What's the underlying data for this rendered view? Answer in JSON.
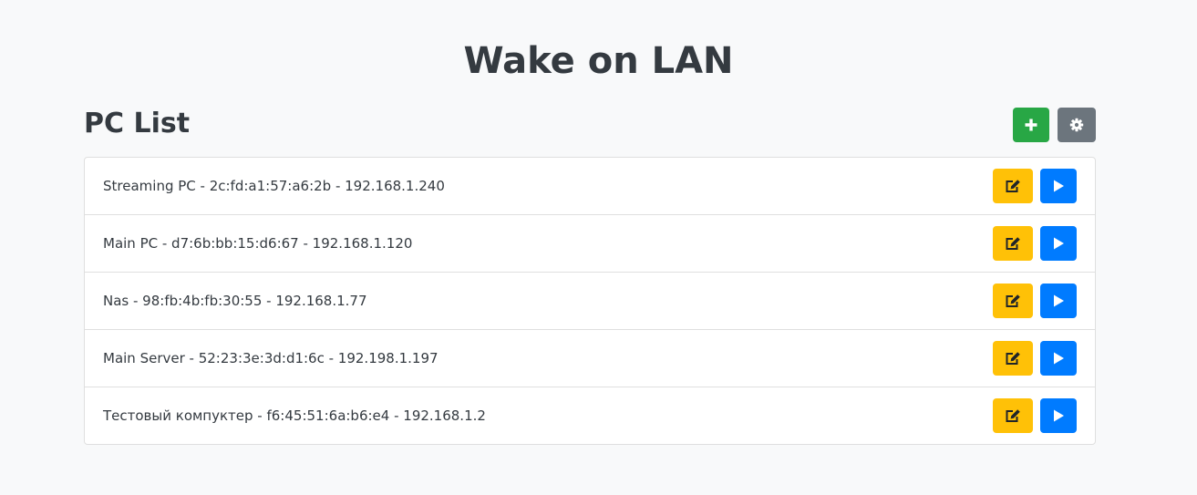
{
  "header": {
    "title": "Wake on LAN"
  },
  "list": {
    "heading": "PC List",
    "add_icon": "plus-icon",
    "settings_icon": "gear-icon",
    "row_edit_icon": "edit-icon",
    "row_wake_icon": "play-icon",
    "items": [
      {
        "label": "Streaming PC - 2c:fd:a1:57:a6:2b - 192.168.1.240"
      },
      {
        "label": "Main PC - d7:6b:bb:15:d6:67 - 192.168.1.120"
      },
      {
        "label": "Nas - 98:fb:4b:fb:30:55 - 192.168.1.77"
      },
      {
        "label": "Main Server - 52:23:3e:3d:d1:6c - 192.198.1.197"
      },
      {
        "label": "Тестовый компуктер - f6:45:51:6a:b6:e4 - 192.168.1.2"
      }
    ]
  },
  "colors": {
    "background": "#f8f9fa",
    "add_button": "#28a745",
    "settings_button": "#6c757d",
    "edit_button": "#ffc107",
    "wake_button": "#007bff"
  }
}
